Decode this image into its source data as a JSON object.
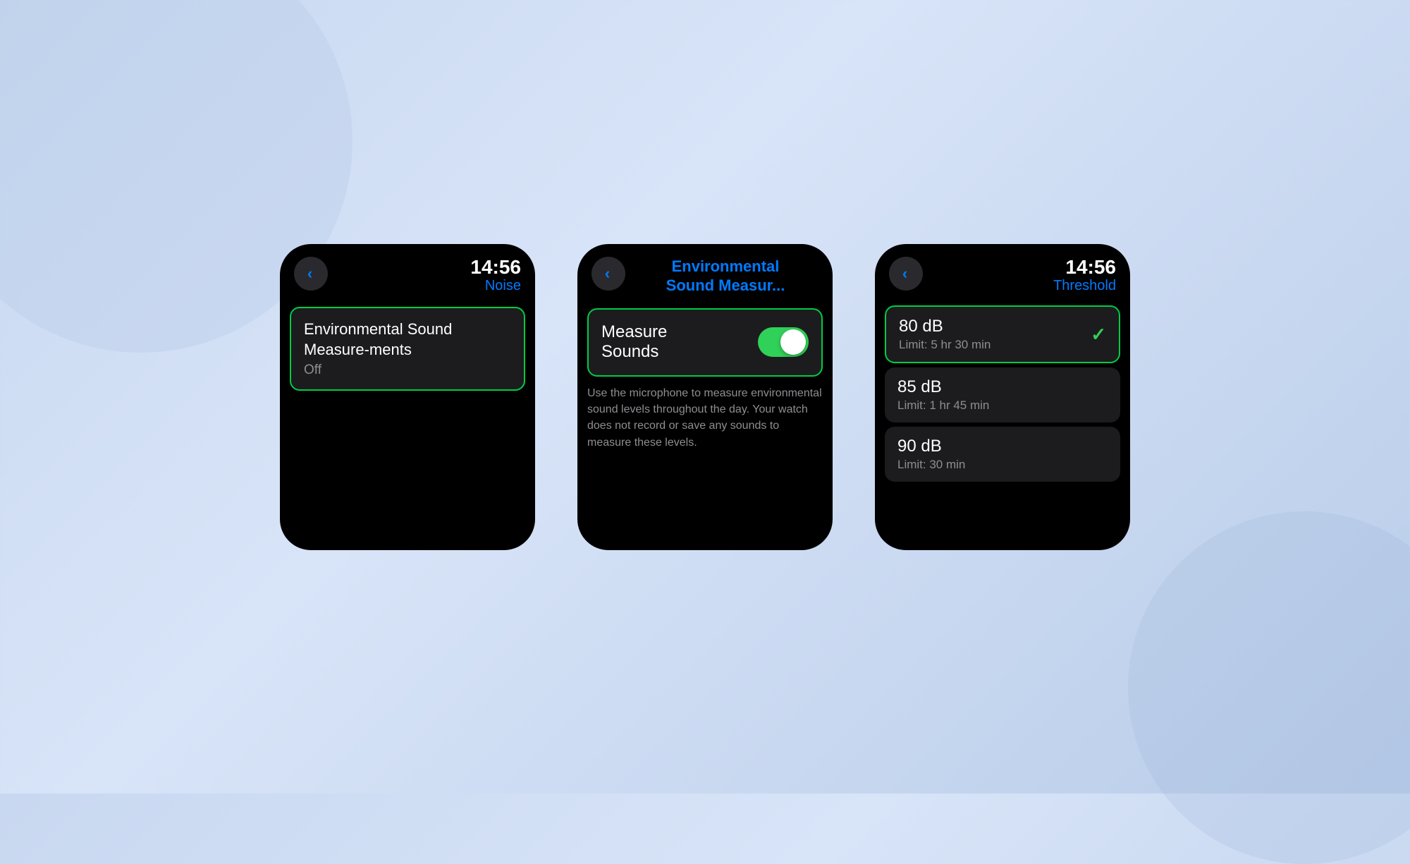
{
  "background_color": "#c8d8f0",
  "screens": [
    {
      "id": "screen1",
      "time": "14:56",
      "nav_title": "Noise",
      "back_label": "<",
      "item": {
        "title": "Environmental Sound Measure-ments",
        "status": "Off",
        "highlighted": true
      }
    },
    {
      "id": "screen2",
      "nav_title_line1": "Environmental",
      "nav_title_line2": "Sound Measur...",
      "back_label": "<",
      "toggle_label_line1": "Measure",
      "toggle_label_line2": "Sounds",
      "toggle_on": true,
      "description": "Use the microphone to measure environmental sound levels throughout the day. Your watch does not record or save any sounds to measure these levels.",
      "highlighted": true
    },
    {
      "id": "screen3",
      "time": "14:56",
      "nav_title": "Threshold",
      "back_label": "<",
      "items": [
        {
          "db": "80 dB",
          "limit": "Limit: 5 hr 30 min",
          "selected": true
        },
        {
          "db": "85 dB",
          "limit": "Limit: 1 hr 45 min",
          "selected": false
        },
        {
          "db": "90 dB",
          "limit": "Limit: 30 min",
          "selected": false
        }
      ]
    }
  ]
}
